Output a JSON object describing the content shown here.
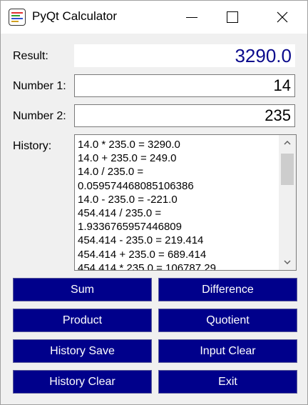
{
  "window": {
    "title": "PyQt Calculator"
  },
  "form": {
    "result_label": "Result:",
    "result_value": "3290.0",
    "number1_label": "Number 1:",
    "number1_value": "14",
    "number2_label": "Number 2:",
    "number2_value": "235",
    "history_label": "History:"
  },
  "history": {
    "lines": [
      "14.0 * 235.0 = 3290.0",
      "14.0 + 235.0 = 249.0",
      "14.0 / 235.0 =",
      "0.059574468085106386",
      "14.0 - 235.0 = -221.0",
      "454.414 / 235.0 =",
      "1.9336765957446809",
      "454.414 - 235.0 = 219.414",
      "454.414 + 235.0 = 689.414",
      "454.414 * 235.0 = 106787.29"
    ]
  },
  "buttons": {
    "sum": "Sum",
    "difference": "Difference",
    "product": "Product",
    "quotient": "Quotient",
    "history_save": "History Save",
    "input_clear": "Input Clear",
    "history_clear": "History Clear",
    "exit": "Exit"
  },
  "colors": {
    "button_bg": "#00008b",
    "result_text": "#0a0a8c"
  }
}
